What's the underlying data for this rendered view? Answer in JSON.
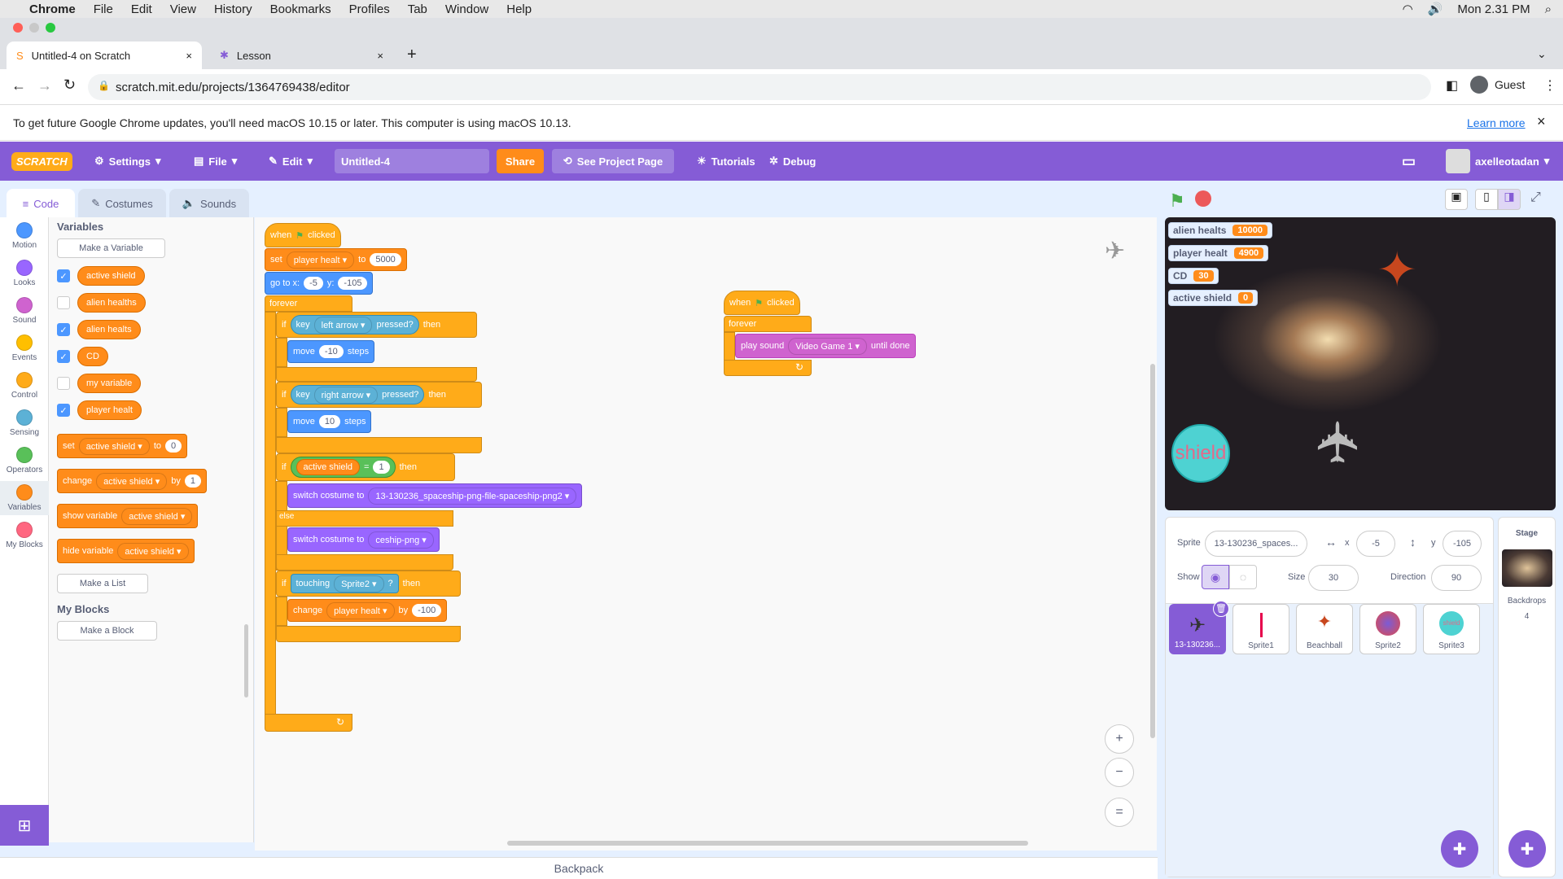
{
  "menubar": {
    "items": [
      "Chrome",
      "File",
      "Edit",
      "View",
      "History",
      "Bookmarks",
      "Profiles",
      "Tab",
      "Window",
      "Help"
    ],
    "clock": "Mon 2.31 PM"
  },
  "tabs": [
    {
      "title": "Untitled-4 on Scratch",
      "close": "×"
    },
    {
      "title": "Lesson",
      "close": "×"
    }
  ],
  "newtab": "+",
  "url": "scratch.mit.edu/projects/1364769438/editor",
  "profile": "Guest",
  "infobar": {
    "text": "To get future Google Chrome updates, you'll need macOS 10.15 or later. This computer is using macOS 10.13.",
    "link": "Learn more",
    "close": "×"
  },
  "header": {
    "logo": "SCRATCH",
    "settings": "Settings",
    "file": "File",
    "edit": "Edit",
    "title": "Untitled-4",
    "share": "Share",
    "see": "See Project Page",
    "tutorials": "Tutorials",
    "debug": "Debug",
    "user": "axelleotadan"
  },
  "edtabs": {
    "code": "Code",
    "costumes": "Costumes",
    "sounds": "Sounds"
  },
  "categories": [
    {
      "label": "Motion",
      "color": "#4c97ff"
    },
    {
      "label": "Looks",
      "color": "#9966ff"
    },
    {
      "label": "Sound",
      "color": "#cf63cf"
    },
    {
      "label": "Events",
      "color": "#ffbf00"
    },
    {
      "label": "Control",
      "color": "#ffab19"
    },
    {
      "label": "Sensing",
      "color": "#5cb1d6"
    },
    {
      "label": "Operators",
      "color": "#59c059"
    },
    {
      "label": "Variables",
      "color": "#ff8c1a"
    },
    {
      "label": "My Blocks",
      "color": "#ff6680"
    }
  ],
  "palette": {
    "heading": "Variables",
    "make_var": "Make a Variable",
    "vars": [
      "active shield",
      "alien healths",
      "alien healts",
      "CD",
      "my variable",
      "player healt"
    ],
    "set": "set",
    "set_var": "active shield",
    "to": "to",
    "set_val": "0",
    "change": "change",
    "change_var": "active shield",
    "by": "by",
    "change_val": "1",
    "show": "show variable",
    "show_var": "active shield",
    "hide": "hide variable",
    "hide_var": "active shield",
    "make_list": "Make a List",
    "myblocks": "My Blocks",
    "make_block": "Make a Block"
  },
  "script1": {
    "when": "when",
    "clicked": "clicked",
    "set": "set",
    "set_var": "player healt",
    "to": "to",
    "set_val": "5000",
    "goto": "go to x:",
    "x": "-5",
    "y_lbl": "y:",
    "y": "-105",
    "forever": "forever",
    "if": "if",
    "key": "key",
    "left": "left arrow",
    "pressed": "pressed?",
    "then": "then",
    "move": "move",
    "move_l": "-10",
    "steps": "steps",
    "right": "right arrow",
    "move_r": "10",
    "shield_var": "active shield",
    "eq": "=",
    "eq_val": "1",
    "switch": "switch costume to",
    "costume1": "13-130236_spaceship-png-file-spaceship-png2",
    "else": "else",
    "costume2": "ceship-png",
    "touching": "touching",
    "touch_target": "Sprite2",
    "q": "?",
    "change": "change",
    "change_var": "player healt",
    "by": "by",
    "change_val": "-100",
    "arrow": "↻"
  },
  "script2": {
    "when": "when",
    "clicked": "clicked",
    "forever": "forever",
    "play": "play sound",
    "sound": "Video Game 1",
    "until": "until done",
    "arrow": "↻"
  },
  "zoom": {
    "in": "+",
    "out": "−",
    "reset": "="
  },
  "backpack": "Backpack",
  "monitors": [
    {
      "name": "alien healts",
      "value": "10000"
    },
    {
      "name": "player healt",
      "value": "4900"
    },
    {
      "name": "CD",
      "value": "30"
    },
    {
      "name": "active shield",
      "value": "0"
    }
  ],
  "stage_shield": "shield",
  "sprite": {
    "label": "Sprite",
    "name": "13-130236_spaces...",
    "x_lbl": "x",
    "x": "-5",
    "y_lbl": "y",
    "y": "-105",
    "show": "Show",
    "size_lbl": "Size",
    "size": "30",
    "dir_lbl": "Direction",
    "dir": "90"
  },
  "sprites": [
    "13-130236...",
    "Sprite1",
    "Beachball",
    "Sprite2",
    "Sprite3"
  ],
  "stagepanel": {
    "title": "Stage",
    "backdrops": "Backdrops",
    "count": "4"
  }
}
